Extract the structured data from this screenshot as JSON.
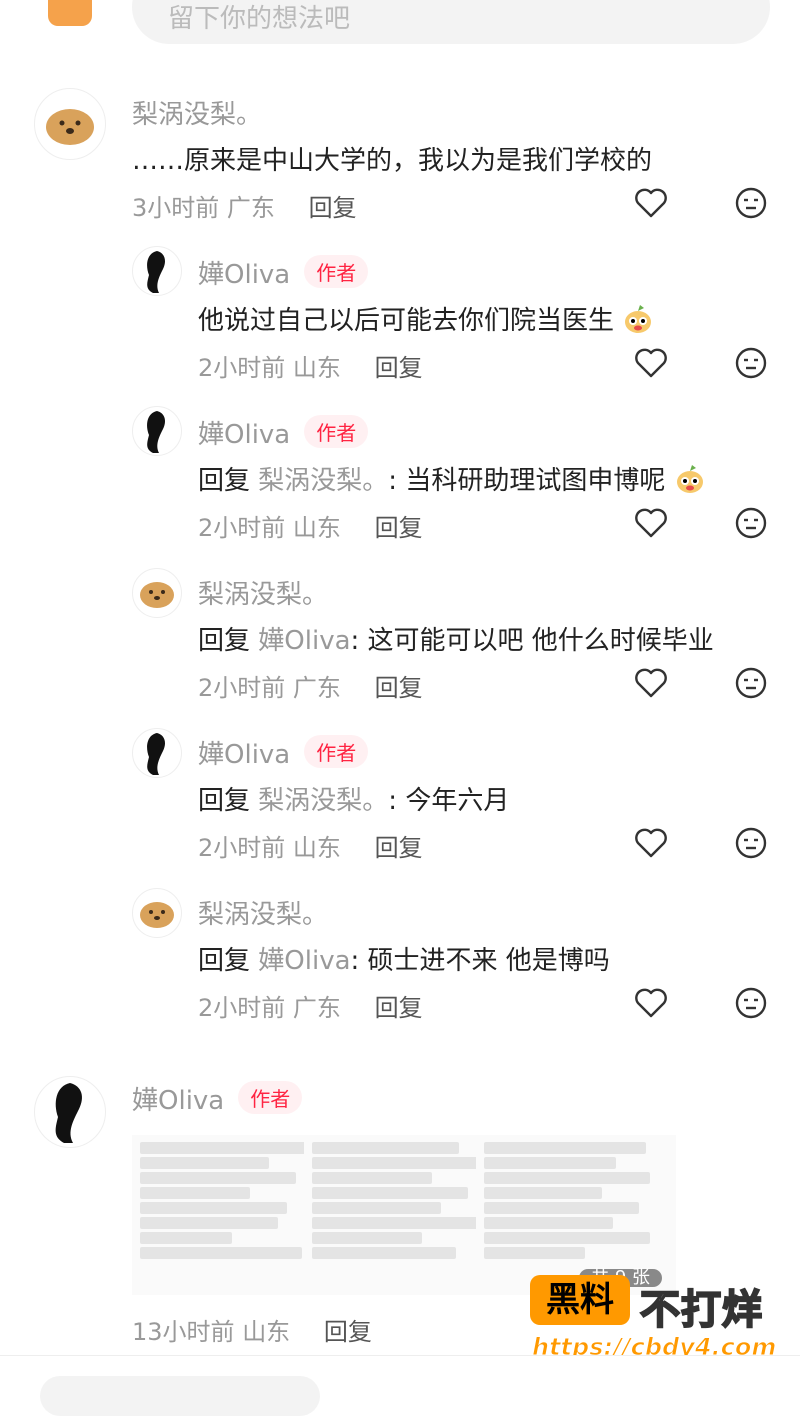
{
  "top_bar": {
    "input_placeholder": "留下你的想法吧"
  },
  "comments": [
    {
      "user": "梨涡没梨。",
      "text": "……原来是中山大学的，我以为是我们学校的",
      "time": "3小时前",
      "location": "广东",
      "reply": "回复"
    },
    {
      "user": "嬅Oliva",
      "tag": "作者",
      "text": "他说过自己以后可能去你们院当医生",
      "time": "2小时前",
      "location": "山东",
      "reply": "回复"
    },
    {
      "user": "嬅Oliva",
      "tag": "作者",
      "prefix": "回复",
      "ref": "梨涡没梨。",
      "text": ": 当科研助理试图申博呢",
      "time": "2小时前",
      "location": "山东",
      "reply": "回复"
    },
    {
      "user": "梨涡没梨。",
      "prefix": "回复",
      "ref": "嬅Oliva",
      "text": ": 这可能可以吧  他什么时候毕业",
      "time": "2小时前",
      "location": "广东",
      "reply": "回复"
    },
    {
      "user": "嬅Oliva",
      "tag": "作者",
      "prefix": "回复",
      "ref": "梨涡没梨。",
      "text": ": 今年六月",
      "time": "2小时前",
      "location": "山东",
      "reply": "回复"
    },
    {
      "user": "梨涡没梨。",
      "prefix": "回复",
      "ref": "嬅Oliva",
      "text": ": 硕士进不来 他是博吗",
      "time": "2小时前",
      "location": "广东",
      "reply": "回复"
    },
    {
      "user": "嬅Oliva",
      "tag": "作者",
      "time": "13小时前",
      "location": "山东",
      "reply": "回复",
      "image_count": "共 9 张"
    }
  ],
  "watermark": {
    "brand": "黑料",
    "slogan": "不打烊",
    "url": "https://cbdy4.com"
  },
  "colors": {
    "author_tag": "#ff2442",
    "muted": "#999999",
    "brand": "#ff9900"
  }
}
